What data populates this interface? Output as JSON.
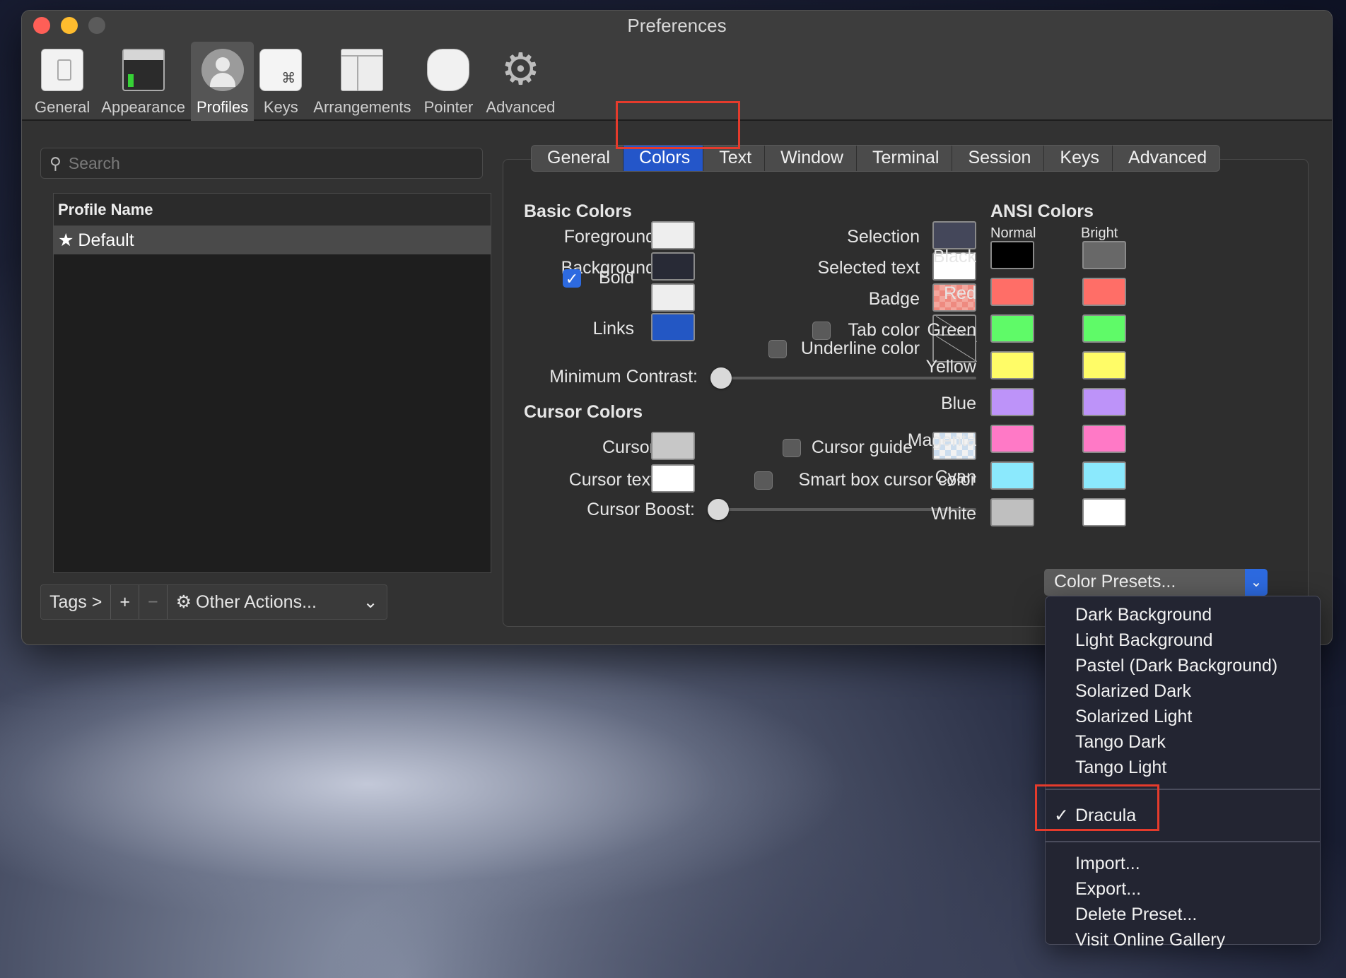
{
  "window": {
    "title": "Preferences"
  },
  "toolbar": {
    "items": [
      {
        "label": "General",
        "icon": "general-icon"
      },
      {
        "label": "Appearance",
        "icon": "appearance-icon"
      },
      {
        "label": "Profiles",
        "icon": "profiles-icon",
        "active": true
      },
      {
        "label": "Keys",
        "icon": "keys-icon",
        "glyph": "⌘"
      },
      {
        "label": "Arrangements",
        "icon": "arrangements-icon"
      },
      {
        "label": "Pointer",
        "icon": "pointer-icon"
      },
      {
        "label": "Advanced",
        "icon": "gear-icon",
        "glyph": "⚙"
      }
    ]
  },
  "sidebar": {
    "search_placeholder": "Search",
    "table_header": "Profile Name",
    "profiles": [
      {
        "name": "Default",
        "star": "★"
      }
    ],
    "bottom": {
      "tags": "Tags >",
      "add": "+",
      "remove": "−",
      "other_actions": "Other Actions...",
      "chevron": "⌄",
      "gear": "⚙"
    }
  },
  "tabs": [
    {
      "label": "General"
    },
    {
      "label": "Colors",
      "active": true
    },
    {
      "label": "Text"
    },
    {
      "label": "Window"
    },
    {
      "label": "Terminal"
    },
    {
      "label": "Session"
    },
    {
      "label": "Keys"
    },
    {
      "label": "Advanced"
    }
  ],
  "basic_colors": {
    "title": "Basic Colors",
    "foreground": {
      "label": "Foreground",
      "color": "#eeeeee"
    },
    "background": {
      "label": "Background",
      "color": "#282a36"
    },
    "bold": {
      "label": "Bold",
      "color": "#eeeeee",
      "checked": true
    },
    "links": {
      "label": "Links",
      "color": "#2357c4"
    },
    "selection": {
      "label": "Selection",
      "color": "#44475a"
    },
    "selected_text": {
      "label": "Selected text",
      "color": "#ffffff"
    },
    "badge": {
      "label": "Badge"
    },
    "tab_color": {
      "label": "Tab color",
      "checked": false
    },
    "underline_color": {
      "label": "Underline color",
      "checked": false
    },
    "min_contrast": {
      "label": "Minimum Contrast:",
      "value": 0
    }
  },
  "cursor_colors": {
    "title": "Cursor Colors",
    "cursor": {
      "label": "Cursor",
      "color": "#c7c7c7"
    },
    "cursor_text": {
      "label": "Cursor text",
      "color": "#ffffff"
    },
    "cursor_guide": {
      "label": "Cursor guide",
      "checked": false
    },
    "smart_box": {
      "label": "Smart box cursor color",
      "checked": false
    },
    "cursor_boost": {
      "label": "Cursor Boost:",
      "value": 0
    }
  },
  "ansi": {
    "title": "ANSI Colors",
    "normal_header": "Normal",
    "bright_header": "Bright",
    "rows": [
      {
        "name": "Black",
        "normal": "#000000",
        "bright": "#686868"
      },
      {
        "name": "Red",
        "normal": "#ff6e67",
        "bright": "#ff6e67"
      },
      {
        "name": "Green",
        "normal": "#5ffa68",
        "bright": "#5ffa68"
      },
      {
        "name": "Yellow",
        "normal": "#fffc67",
        "bright": "#fffc67"
      },
      {
        "name": "Blue",
        "normal": "#bd93f9",
        "bright": "#bd93f9"
      },
      {
        "name": "Magenta",
        "normal": "#ff79c6",
        "bright": "#ff79c6"
      },
      {
        "name": "Cyan",
        "normal": "#8be9fd",
        "bright": "#8be9fd"
      },
      {
        "name": "White",
        "normal": "#bfbfbf",
        "bright": "#ffffff"
      }
    ]
  },
  "presets": {
    "button_label": "Color Presets...",
    "menu_group1": [
      "Dark Background",
      "Light Background",
      "Pastel (Dark Background)",
      "Solarized Dark",
      "Solarized Light",
      "Tango Dark",
      "Tango Light"
    ],
    "selected": "Dracula",
    "check": "✓",
    "menu_group2": [
      "Import...",
      "Export...",
      "Delete Preset...",
      "Visit Online Gallery"
    ]
  },
  "colors": {
    "accent": "#2456c9",
    "highlight_box": "#e53b2c"
  }
}
